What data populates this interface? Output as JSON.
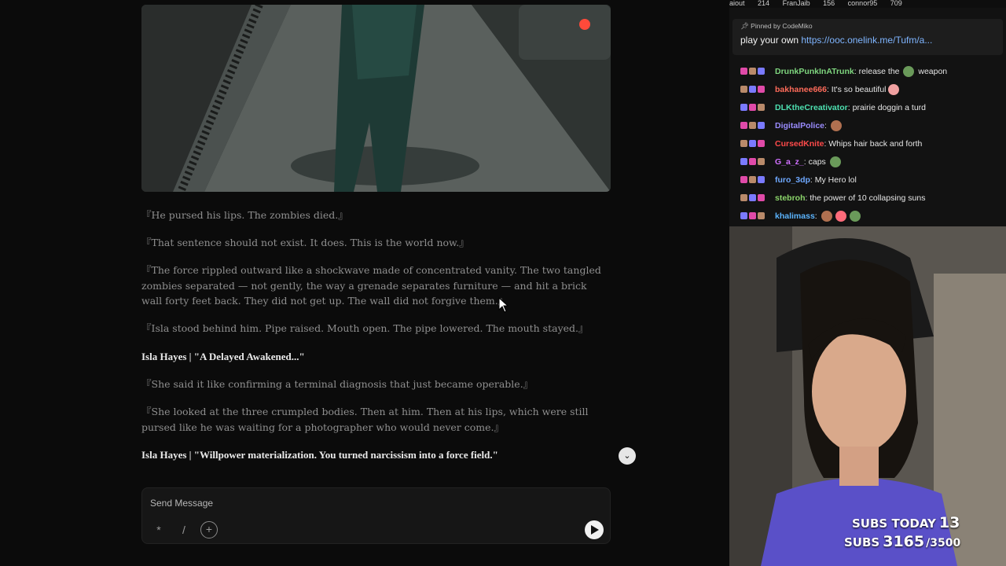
{
  "story": {
    "paragraphs": [
      "『He pursed his lips. The zombies died.』",
      "『That sentence should not exist. It does. This is the world now.』",
      "『The force rippled outward like a shockwave made of concentrated vanity. The two tangled zombies separated — not gently, the way a grenade separates furniture — and hit a brick wall forty feet back. They did not get up. The wall did not forgive them.』",
      "『Isla stood behind him. Pipe raised. Mouth open. The pipe lowered. The mouth stayed.』"
    ],
    "speaker_1": "Isla Hayes | \"A Delayed Awakened...\"",
    "paragraphs_2": [
      "『She said it like confirming a terminal diagnosis that just became operable.』",
      "『She looked at the three crumpled bodies. Then at him. Then at his lips, which were still pursed like he was waiting for a photographer who would never come.』"
    ],
    "speaker_2": "Isla Hayes | \"Willpower materialization. You turned narcissism into a force field.\""
  },
  "composer": {
    "placeholder": "Send Message",
    "btn_asterisk": "*",
    "btn_slash": "/",
    "btn_add_icon": "plus-sparkle-icon",
    "send_icon": "play-send-icon"
  },
  "stream": {
    "top_strip": [
      "aiout",
      "214",
      "FranJaib",
      "156",
      "connor95",
      "709"
    ],
    "pinned": {
      "by_label": "Pinned by",
      "by_user": "CodeMiko",
      "message": "play your own ",
      "link": "https://ooc.onelink.me/Tufm/a..."
    },
    "chat": [
      {
        "user": "DrunkPunkInATrunk",
        "color": "#7fd67f",
        "pre": ": release the ",
        "post": " weapon",
        "emotes": 1
      },
      {
        "user": "bakhanee666",
        "color": "#ff6b5a",
        "pre": ": It's so beautiful",
        "post": "",
        "emotes": 1
      },
      {
        "user": "DLKtheCreativator",
        "color": "#4de0b0",
        "pre": ": prairie doggin a turd",
        "post": "",
        "emotes": 0
      },
      {
        "user": "DigitalPolice",
        "color": "#9a8cff",
        "pre": ": ",
        "post": "",
        "emotes": 1
      },
      {
        "user": "CursedKnite",
        "color": "#ff4a4a",
        "pre": ": Whips hair back and forth",
        "post": "",
        "emotes": 0
      },
      {
        "user": "G_a_z_",
        "color": "#d070ff",
        "pre": ": caps ",
        "post": "",
        "emotes": 1
      },
      {
        "user": "furo_3dp",
        "color": "#6ea8ff",
        "pre": ": My Hero lol",
        "post": "",
        "emotes": 0
      },
      {
        "user": "stebroh",
        "color": "#8cd66b",
        "pre": ": the power of 10 collapsing suns",
        "post": "",
        "emotes": 0
      },
      {
        "user": "khalimass",
        "color": "#5bb4ff",
        "pre": ": ",
        "post": "",
        "emotes": 3
      }
    ],
    "subs_today_label": "SUBS TODAY",
    "subs_today": "13",
    "subs_label": "SUBS",
    "subs_total": "3165",
    "subs_goal": "/3500"
  },
  "colors": {
    "background": "#0b0b0b",
    "narration": "#8f8f8f",
    "speaker": "#eaeaea",
    "link": "#7fb5ff"
  }
}
